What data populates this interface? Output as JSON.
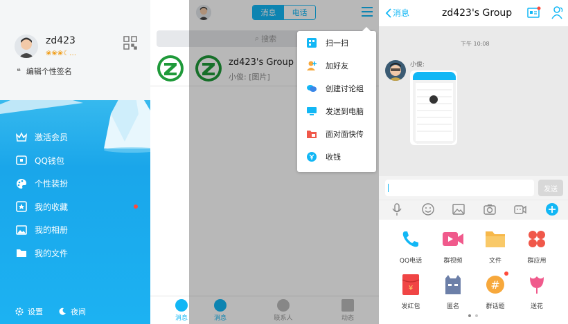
{
  "drawer": {
    "username": "zd423",
    "level_icons": "❀❀❀☾…",
    "signature": "编辑个性签名",
    "menu": [
      {
        "label": "激活会员",
        "icon": "crown-icon"
      },
      {
        "label": "QQ钱包",
        "icon": "wallet-icon"
      },
      {
        "label": "个性装扮",
        "icon": "palette-icon"
      },
      {
        "label": "我的收藏",
        "icon": "star-box-icon",
        "badge": true
      },
      {
        "label": "我的相册",
        "icon": "photo-icon"
      },
      {
        "label": "我的文件",
        "icon": "folder-icon"
      }
    ],
    "settings_label": "设置",
    "night_label": "夜间"
  },
  "messages": {
    "tab_messages": "消息",
    "tab_calls": "电话",
    "search_placeholder": "搜索",
    "conversation": {
      "name": "zd423's Group",
      "last": "小俊: [图片]"
    },
    "tabbar": [
      {
        "label": "消息",
        "active": true
      },
      {
        "label": "联系人",
        "active": false
      },
      {
        "label": "动态",
        "active": false
      }
    ],
    "left_tab_label": "消息",
    "popup": [
      {
        "label": "扫一扫",
        "icon": "scan-icon"
      },
      {
        "label": "加好友",
        "icon": "add-friend-icon"
      },
      {
        "label": "创建讨论组",
        "icon": "discussion-icon"
      },
      {
        "label": "发送到电脑",
        "icon": "computer-icon"
      },
      {
        "label": "面对面快传",
        "icon": "face-transfer-icon"
      },
      {
        "label": "收钱",
        "icon": "money-icon"
      }
    ]
  },
  "chat": {
    "back_label": "消息",
    "title": "zd423's Group",
    "time": "下午 10:08",
    "sender": "小俊:",
    "send_label": "发送",
    "grid": [
      {
        "label": "QQ电话",
        "icon": "phone-icon",
        "color": "#12b7f5"
      },
      {
        "label": "群视频",
        "icon": "video-icon",
        "color": "#f05a8c"
      },
      {
        "label": "文件",
        "icon": "folder-icon",
        "color": "#f7b84a"
      },
      {
        "label": "群应用",
        "icon": "apps-icon",
        "color": "#f0584a"
      },
      {
        "label": "发红包",
        "icon": "red-packet-icon",
        "color": "#f04545"
      },
      {
        "label": "匿名",
        "icon": "anonymous-icon",
        "color": "#6c7fa8"
      },
      {
        "label": "群话题",
        "icon": "topic-icon",
        "color": "#f7a83c",
        "badge": true
      },
      {
        "label": "送花",
        "icon": "flower-icon",
        "color": "#f05a8c"
      }
    ]
  },
  "colors": {
    "accent": "#12b7f5",
    "badge": "#ff4a3a"
  }
}
